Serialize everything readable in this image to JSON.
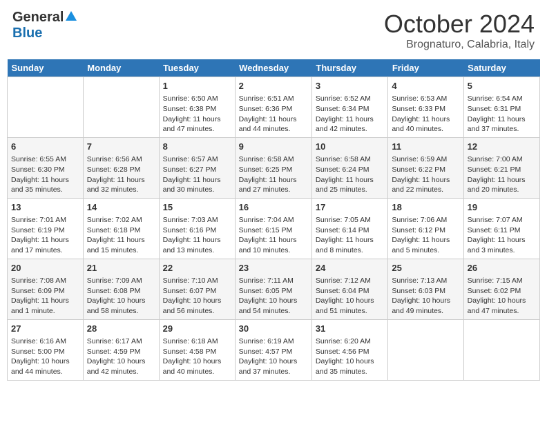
{
  "header": {
    "logo_general": "General",
    "logo_blue": "Blue",
    "month_title": "October 2024",
    "location": "Brognaturo, Calabria, Italy"
  },
  "days_of_week": [
    "Sunday",
    "Monday",
    "Tuesday",
    "Wednesday",
    "Thursday",
    "Friday",
    "Saturday"
  ],
  "weeks": [
    [
      {
        "day": "",
        "info": ""
      },
      {
        "day": "",
        "info": ""
      },
      {
        "day": "1",
        "info": "Sunrise: 6:50 AM\nSunset: 6:38 PM\nDaylight: 11 hours and 47 minutes."
      },
      {
        "day": "2",
        "info": "Sunrise: 6:51 AM\nSunset: 6:36 PM\nDaylight: 11 hours and 44 minutes."
      },
      {
        "day": "3",
        "info": "Sunrise: 6:52 AM\nSunset: 6:34 PM\nDaylight: 11 hours and 42 minutes."
      },
      {
        "day": "4",
        "info": "Sunrise: 6:53 AM\nSunset: 6:33 PM\nDaylight: 11 hours and 40 minutes."
      },
      {
        "day": "5",
        "info": "Sunrise: 6:54 AM\nSunset: 6:31 PM\nDaylight: 11 hours and 37 minutes."
      }
    ],
    [
      {
        "day": "6",
        "info": "Sunrise: 6:55 AM\nSunset: 6:30 PM\nDaylight: 11 hours and 35 minutes."
      },
      {
        "day": "7",
        "info": "Sunrise: 6:56 AM\nSunset: 6:28 PM\nDaylight: 11 hours and 32 minutes."
      },
      {
        "day": "8",
        "info": "Sunrise: 6:57 AM\nSunset: 6:27 PM\nDaylight: 11 hours and 30 minutes."
      },
      {
        "day": "9",
        "info": "Sunrise: 6:58 AM\nSunset: 6:25 PM\nDaylight: 11 hours and 27 minutes."
      },
      {
        "day": "10",
        "info": "Sunrise: 6:58 AM\nSunset: 6:24 PM\nDaylight: 11 hours and 25 minutes."
      },
      {
        "day": "11",
        "info": "Sunrise: 6:59 AM\nSunset: 6:22 PM\nDaylight: 11 hours and 22 minutes."
      },
      {
        "day": "12",
        "info": "Sunrise: 7:00 AM\nSunset: 6:21 PM\nDaylight: 11 hours and 20 minutes."
      }
    ],
    [
      {
        "day": "13",
        "info": "Sunrise: 7:01 AM\nSunset: 6:19 PM\nDaylight: 11 hours and 17 minutes."
      },
      {
        "day": "14",
        "info": "Sunrise: 7:02 AM\nSunset: 6:18 PM\nDaylight: 11 hours and 15 minutes."
      },
      {
        "day": "15",
        "info": "Sunrise: 7:03 AM\nSunset: 6:16 PM\nDaylight: 11 hours and 13 minutes."
      },
      {
        "day": "16",
        "info": "Sunrise: 7:04 AM\nSunset: 6:15 PM\nDaylight: 11 hours and 10 minutes."
      },
      {
        "day": "17",
        "info": "Sunrise: 7:05 AM\nSunset: 6:14 PM\nDaylight: 11 hours and 8 minutes."
      },
      {
        "day": "18",
        "info": "Sunrise: 7:06 AM\nSunset: 6:12 PM\nDaylight: 11 hours and 5 minutes."
      },
      {
        "day": "19",
        "info": "Sunrise: 7:07 AM\nSunset: 6:11 PM\nDaylight: 11 hours and 3 minutes."
      }
    ],
    [
      {
        "day": "20",
        "info": "Sunrise: 7:08 AM\nSunset: 6:09 PM\nDaylight: 11 hours and 1 minute."
      },
      {
        "day": "21",
        "info": "Sunrise: 7:09 AM\nSunset: 6:08 PM\nDaylight: 10 hours and 58 minutes."
      },
      {
        "day": "22",
        "info": "Sunrise: 7:10 AM\nSunset: 6:07 PM\nDaylight: 10 hours and 56 minutes."
      },
      {
        "day": "23",
        "info": "Sunrise: 7:11 AM\nSunset: 6:05 PM\nDaylight: 10 hours and 54 minutes."
      },
      {
        "day": "24",
        "info": "Sunrise: 7:12 AM\nSunset: 6:04 PM\nDaylight: 10 hours and 51 minutes."
      },
      {
        "day": "25",
        "info": "Sunrise: 7:13 AM\nSunset: 6:03 PM\nDaylight: 10 hours and 49 minutes."
      },
      {
        "day": "26",
        "info": "Sunrise: 7:15 AM\nSunset: 6:02 PM\nDaylight: 10 hours and 47 minutes."
      }
    ],
    [
      {
        "day": "27",
        "info": "Sunrise: 6:16 AM\nSunset: 5:00 PM\nDaylight: 10 hours and 44 minutes."
      },
      {
        "day": "28",
        "info": "Sunrise: 6:17 AM\nSunset: 4:59 PM\nDaylight: 10 hours and 42 minutes."
      },
      {
        "day": "29",
        "info": "Sunrise: 6:18 AM\nSunset: 4:58 PM\nDaylight: 10 hours and 40 minutes."
      },
      {
        "day": "30",
        "info": "Sunrise: 6:19 AM\nSunset: 4:57 PM\nDaylight: 10 hours and 37 minutes."
      },
      {
        "day": "31",
        "info": "Sunrise: 6:20 AM\nSunset: 4:56 PM\nDaylight: 10 hours and 35 minutes."
      },
      {
        "day": "",
        "info": ""
      },
      {
        "day": "",
        "info": ""
      }
    ]
  ]
}
